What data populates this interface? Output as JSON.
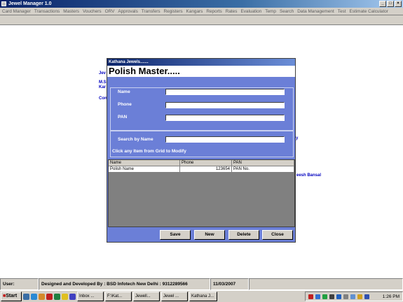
{
  "window": {
    "title": "Jewel Manager 1.0"
  },
  "menu": [
    "Card Manager",
    "Transactions",
    "Masters",
    "Vouchers",
    "ORV",
    "Approvals",
    "Transfers",
    "Registers",
    "Kangars",
    "Reports",
    "Rates",
    "Evaluation",
    "Temp",
    "Search",
    "Data Management",
    "Test",
    "Estimate Calculator"
  ],
  "background_text": {
    "jew": "Jev",
    "ms": "M.S",
    "kar": "Kar",
    "con": "Con",
    "y": "y",
    "bansal": "eesh Bansal"
  },
  "dialog": {
    "title": "Kathana Jewels.......",
    "header": "Polish Master.....",
    "labels": {
      "name": "Name",
      "phone": "Phone",
      "pan": "PAN",
      "search": "Search by Name"
    },
    "hint": "Click any Item from Grid to Modify",
    "values": {
      "name": "",
      "phone": "",
      "pan": "",
      "search": ""
    },
    "grid": {
      "columns": [
        "Name",
        "Phone",
        "PAN"
      ],
      "rows": [
        {
          "name": "Polish Name",
          "phone": "123654",
          "pan": "PAN No."
        }
      ]
    },
    "buttons": {
      "save": "Save",
      "new": "New",
      "delete": "Delete",
      "close": "Close"
    }
  },
  "status": {
    "user": "User:",
    "designer": "Designed and Developed By : BSD Infotech New Delhi : 9312289566",
    "date": "11/03/2007"
  },
  "taskbar": {
    "start": "Start",
    "tasks": [
      "Inbox ...",
      "F:\\Kat...",
      "Jewell...",
      "Jewel ...",
      "Kathana J..."
    ],
    "clock": "1:26 PM"
  },
  "colors": {
    "dialog_bg": "#6b7fd7",
    "accent_text": "#0000c0"
  }
}
